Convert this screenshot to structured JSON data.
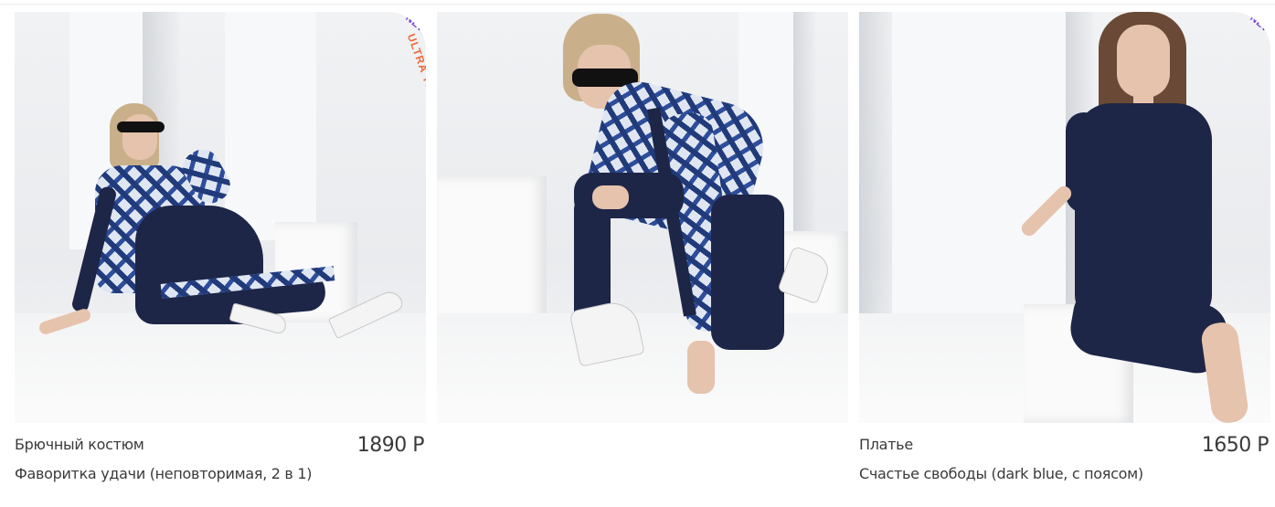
{
  "products": [
    {
      "category": "Брючный костюм",
      "name": "Фаворитка удачи (неповторимая, 2 в 1)",
      "price": "1890 Р",
      "badge_new": "NEW",
      "badge_trend": "ULTRA TREND"
    },
    {
      "category": "",
      "name": "",
      "price": ""
    },
    {
      "category": "Платье",
      "name": "Счастье свободы (dark blue, с поясом)",
      "price": "1650 Р",
      "badge_new": "NEW"
    }
  ],
  "colors": {
    "price_text": "#3a3a3a",
    "badge_new": "#7a3fd1",
    "badge_trend": "#ef6a3a",
    "garment_navy": "#1d2647"
  }
}
